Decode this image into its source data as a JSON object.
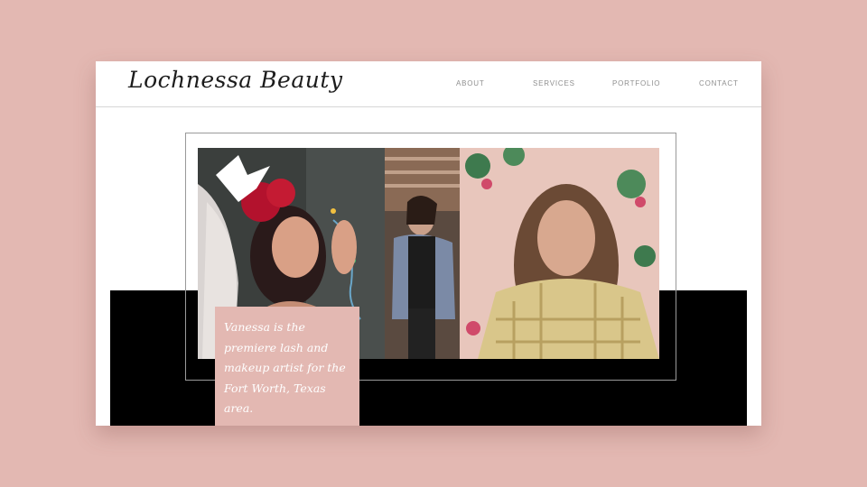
{
  "header": {
    "logo": "Lochnessa Beauty",
    "nav": [
      {
        "label": "ABOUT"
      },
      {
        "label": "SERVICES"
      },
      {
        "label": "PORTFOLIO"
      },
      {
        "label": "CONTACT"
      }
    ]
  },
  "hero": {
    "caption": "Vanessa is the premiere lash and makeup artist for the Fort Worth, Texas area."
  },
  "colors": {
    "background": "#e3b8b2",
    "caption_box": "#e3b8b2",
    "band": "#000000"
  }
}
